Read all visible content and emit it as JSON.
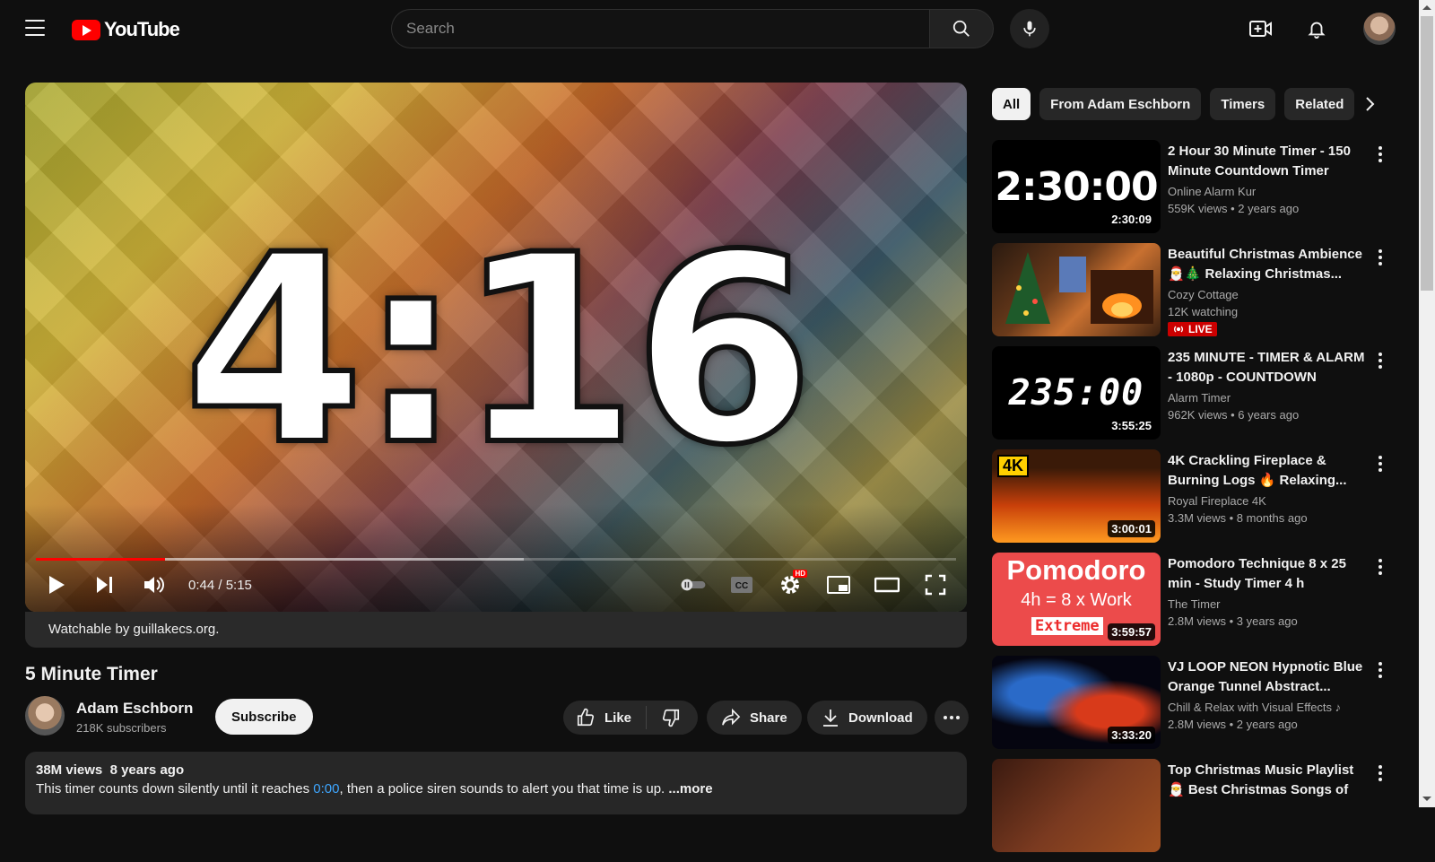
{
  "header": {
    "logo_text": "YouTube",
    "search_placeholder": "Search"
  },
  "player": {
    "display_time": "4:16",
    "time_text": "0:44 / 5:15",
    "progress": 0.14,
    "buffered": 0.53,
    "hd_badge": "HD",
    "attribution": "Watchable by guillakecs.org."
  },
  "video": {
    "title": "5 Minute Timer",
    "channel_name": "Adam Eschborn",
    "subscribers": "218K subscribers",
    "subscribe_label": "Subscribe",
    "like_label": "Like",
    "share_label": "Share",
    "download_label": "Download"
  },
  "description": {
    "views": "38M views",
    "age": "8 years ago",
    "text_before": "This timer counts down silently until it reaches ",
    "timestamp_link": "0:00",
    "text_after": ", then a police siren sounds to alert you that time is up. ",
    "more_label": "...more"
  },
  "chips": [
    "All",
    "From Adam Eschborn",
    "Timers",
    "Related"
  ],
  "recommendations": [
    {
      "title": "2 Hour 30 Minute Timer - 150 Minute Countdown Timer",
      "channel": "Online Alarm Kur",
      "meta": "559K views  • 2 years ago",
      "duration": "2:30:09",
      "thumb_text": "2:30:00"
    },
    {
      "title": "Beautiful Christmas Ambience 🎅🎄 Relaxing Christmas...",
      "channel": "Cozy Cottage",
      "meta": "12K watching",
      "live_label": "LIVE"
    },
    {
      "title": "235 MINUTE - TIMER & ALARM - 1080p - COUNTDOWN",
      "channel": "Alarm Timer",
      "meta": "962K views  • 6 years ago",
      "duration": "3:55:25",
      "thumb_text": "235:00"
    },
    {
      "title": "4K Crackling Fireplace & Burning Logs 🔥 Relaxing...",
      "channel": "Royal Fireplace 4K",
      "meta": "3.3M views  • 8 months ago",
      "duration": "3:00:01",
      "thumb_badge": "4K"
    },
    {
      "title": "Pomodoro Technique 8 x 25 min - Study Timer 4 h",
      "channel": "The Timer",
      "meta": "2.8M views  • 3 years ago",
      "duration": "3:59:57",
      "thumb_line1": "Pomodoro",
      "thumb_line2": "4h = 8 x Work",
      "thumb_line3": "Extreme"
    },
    {
      "title": "VJ LOOP NEON Hypnotic Blue Orange Tunnel Abstract...",
      "channel": "Chill & Relax with Visual Effects ♪",
      "meta": "2.8M views  • 2 years ago",
      "duration": "3:33:20"
    },
    {
      "title": "Top Christmas Music Playlist 🎅 Best Christmas Songs of A..."
    }
  ]
}
